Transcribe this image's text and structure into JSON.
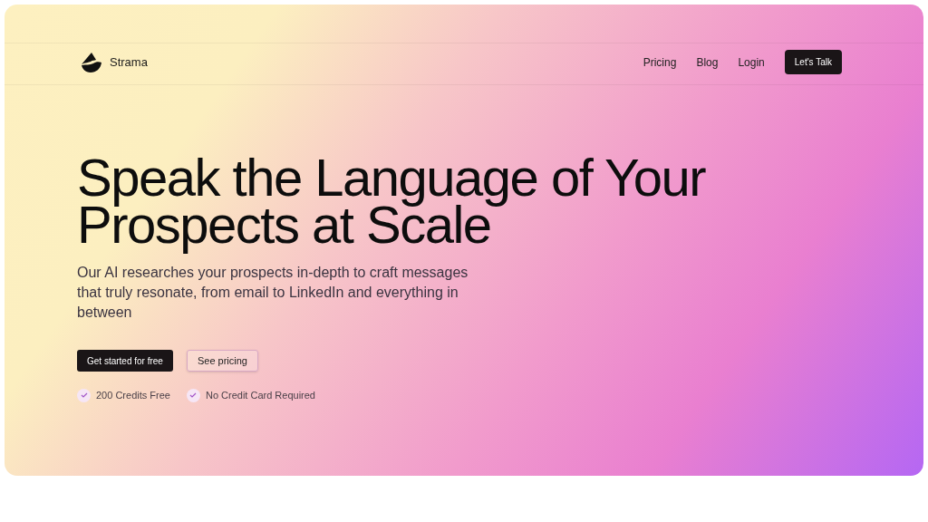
{
  "brand": {
    "name": "Strama"
  },
  "nav": {
    "links": [
      "Pricing",
      "Blog",
      "Login"
    ],
    "cta": "Let's Talk"
  },
  "hero": {
    "title_lines": [
      "Speak the Language of Your",
      "Prospects at Scale"
    ],
    "subtitle": "Our AI researches your prospects in-depth to craft messages that truly resonate, from email to LinkedIn and everything in between",
    "buttons": [
      {
        "label": "Get started for free",
        "kind": "primary"
      },
      {
        "label": "See pricing",
        "kind": "secondary"
      }
    ],
    "features": [
      "200 Credits Free",
      "No Credit Card Required"
    ]
  }
}
